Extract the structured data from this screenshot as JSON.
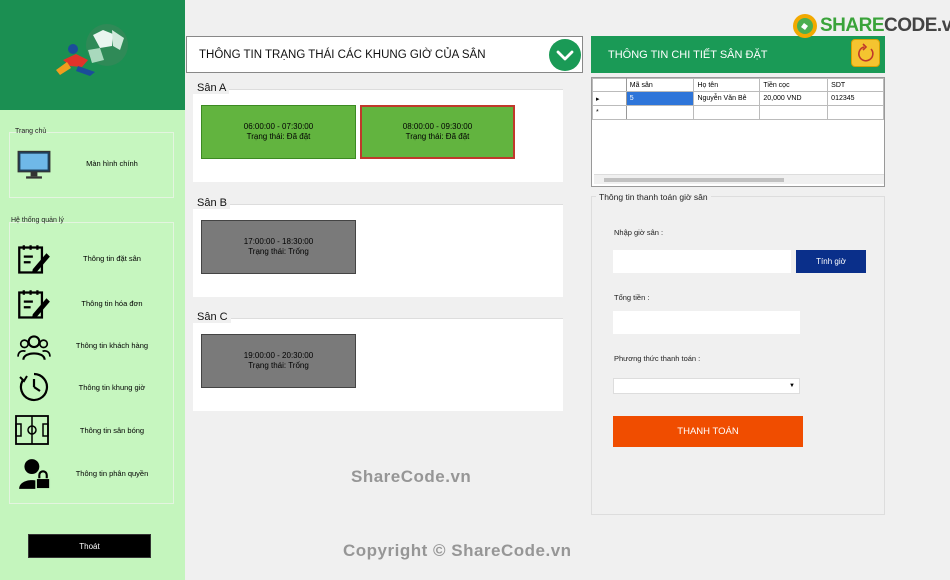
{
  "brand": {
    "share": "SHARE",
    "code": "CODE.vn"
  },
  "sidebar": {
    "home_group": "Trang chủ",
    "home_item": "Màn hình chính",
    "mgmt_group": "Hệ thống quản lý",
    "items": [
      {
        "label": "Thông tin đặt sân",
        "icon": "edit-document-icon"
      },
      {
        "label": "Thông tin hóa đơn",
        "icon": "edit-document-icon"
      },
      {
        "label": "Thông tin khách hàng",
        "icon": "users-icon"
      },
      {
        "label": "Thông tin khung giờ",
        "icon": "clock-icon"
      },
      {
        "label": "Thông tin sân bóng",
        "icon": "soccer-field-icon"
      },
      {
        "label": "Thông tin phân quyền",
        "icon": "user-lock-icon"
      }
    ],
    "exit_label": "Thoát"
  },
  "status": {
    "title": "THÔNG TIN TRẠNG THÁI CÁC KHUNG GIỜ CỦA SÂN",
    "courts": [
      {
        "name": "Sân A",
        "slots": [
          {
            "time": "06:00:00 - 07:30:00",
            "status": "Trạng thái: Đã đặt"
          },
          {
            "time": "08:00:00 - 09:30:00",
            "status": "Trạng thái: Đã đặt"
          }
        ]
      },
      {
        "name": "Sân B",
        "slots": [
          {
            "time": "17:00:00 - 18:30:00",
            "status": "Trạng thái: Trống"
          }
        ]
      },
      {
        "name": "Sân C",
        "slots": [
          {
            "time": "19:00:00 - 20:30:00",
            "status": "Trạng thái: Trống"
          }
        ]
      }
    ]
  },
  "detail": {
    "title": "THÔNG TIN CHI TIẾT SÂN ĐẶT",
    "columns": [
      "Mã sân",
      "Họ tên",
      "Tiền cọc",
      "SDT"
    ],
    "rows": [
      {
        "ma_san": "5",
        "ho_ten": "Nguyễn Văn Bê",
        "tien_coc": "20,000 VND",
        "sdt": "012345"
      }
    ]
  },
  "payment": {
    "title": "Thông tin thanh toán giờ sân",
    "hours_label": "Nhập giờ sân :",
    "hours_value": "",
    "calc_label": "Tính giờ",
    "total_label": "Tổng tiền :",
    "total_value": "",
    "method_label": "Phương thức thanh toán :",
    "method_value": "",
    "pay_label": "THANH TOÁN"
  },
  "watermarks": {
    "center": "ShareCode.vn",
    "footer": "Copyright © ShareCode.vn"
  },
  "colors": {
    "primary_green": "#1a9a56",
    "sidebar_bg": "#c4f5bd",
    "pay_orange": "#f04d00",
    "calc_blue": "#0a2f8a"
  }
}
